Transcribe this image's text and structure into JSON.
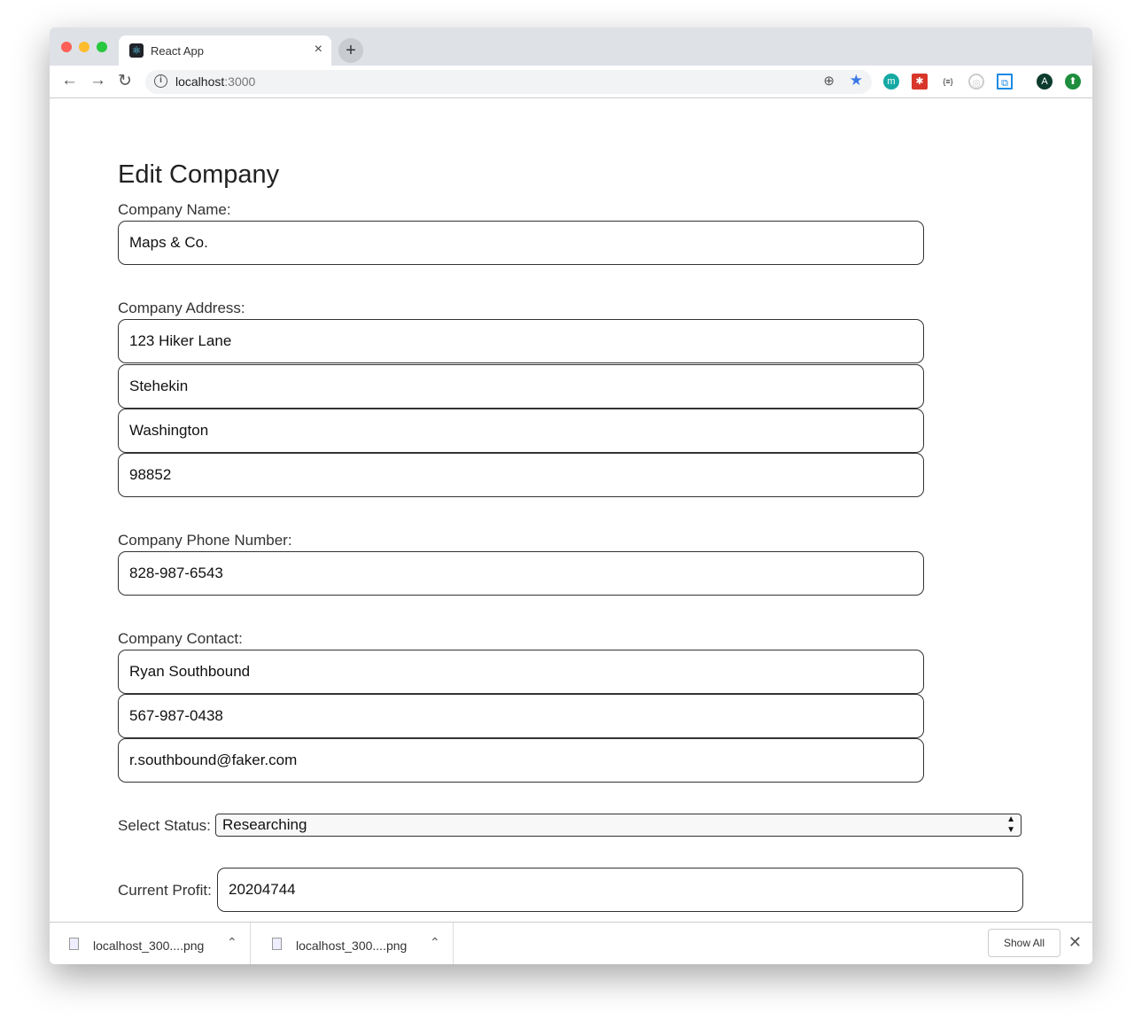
{
  "browser": {
    "tab_title": "React App",
    "url_host": "localhost",
    "url_port": ":3000",
    "extensions": [
      "motion-icon",
      "red-extension-icon",
      "json-formatter-icon",
      "target-icon",
      "screenshot-icon"
    ],
    "profile_initial": "A"
  },
  "page": {
    "title": "Edit Company",
    "name_label": "Company Name:",
    "name": "Maps & Co.",
    "address_label": "Company Address:",
    "street": "123 Hiker Lane",
    "city": "Stehekin",
    "state": "Washington",
    "zip": "98852",
    "phone_label": "Company Phone Number:",
    "phone": "828-987-6543",
    "contact_label": "Company Contact:",
    "contact_name": "Ryan Southbound",
    "contact_phone": "567-987-0438",
    "contact_email": "r.southbound@faker.com",
    "status_label": "Select Status:",
    "status": "Researching",
    "profit_label": "Current Profit:",
    "profit": "20204744"
  },
  "downloads": {
    "items": [
      "localhost_300....png",
      "localhost_300....png"
    ],
    "show_all": "Show All"
  }
}
